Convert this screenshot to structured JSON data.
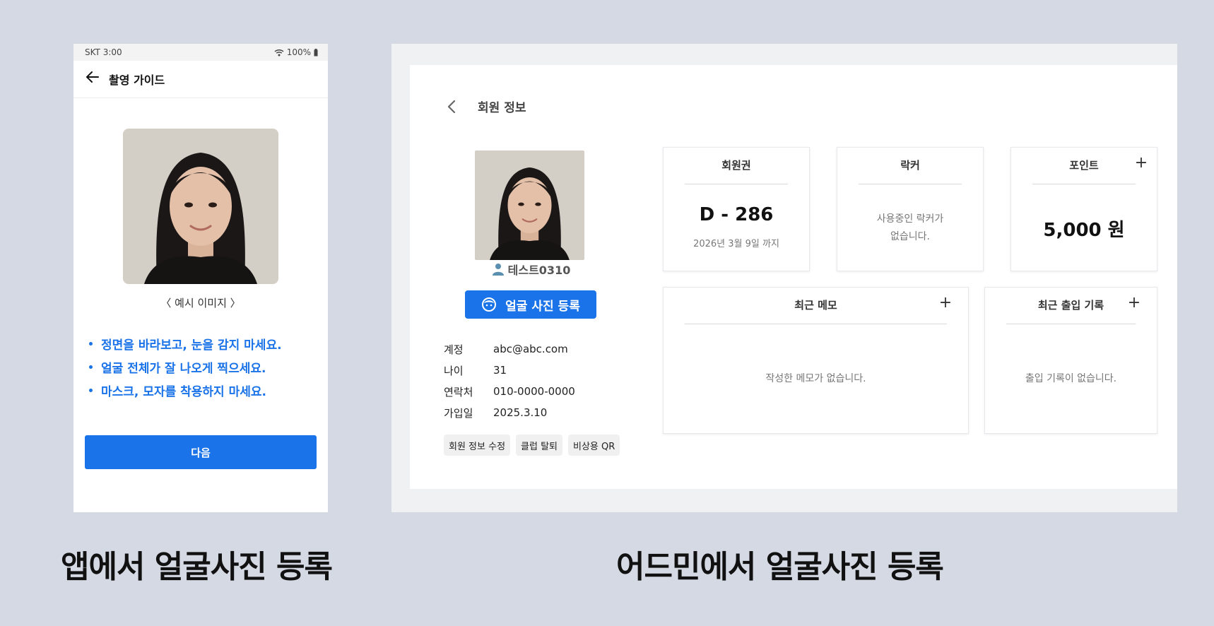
{
  "phone": {
    "status": {
      "carrier_time": "SKT 3:00",
      "battery": "100%"
    },
    "title": "촬영 가이드",
    "photo_caption": "〈 예시 이미지 〉",
    "guide_items": [
      "정면을 바라보고, 눈을 감지 마세요.",
      "얼굴 전체가 잘 나오게 찍으세요.",
      "마스크, 모자를 착용하지 마세요."
    ],
    "next_label": "다음"
  },
  "admin": {
    "title": "회원 정보",
    "profile": {
      "name": "테스트0310",
      "face_button": "얼굴 사진 등록"
    },
    "info": [
      {
        "key": "계정",
        "value": "abc@abc.com"
      },
      {
        "key": "나이",
        "value": "31"
      },
      {
        "key": "연락처",
        "value": "010-0000-0000"
      },
      {
        "key": "가입일",
        "value": "2025.3.10"
      }
    ],
    "actions": [
      "회원 정보 수정",
      "클럽 탈퇴",
      "비상용 QR"
    ],
    "cards": {
      "membership": {
        "title": "회원권",
        "value": "D - 286",
        "sub": "2026년 3월 9일 까지"
      },
      "locker": {
        "title": "락커",
        "empty_line1": "사용중인 락커가",
        "empty_line2": "없습니다."
      },
      "points": {
        "title": "포인트",
        "value": "5,000 원",
        "plus": "+"
      },
      "memo": {
        "title": "최근 메모",
        "empty": "작성한 메모가 없습니다.",
        "plus": "+"
      },
      "access": {
        "title": "최근 출입 기록",
        "empty": "출입 기록이 없습니다.",
        "plus": "+"
      }
    }
  },
  "captions": {
    "left": "앱에서 얼굴사진 등록",
    "right": "어드민에서 얼굴사진 등록"
  },
  "colors": {
    "background": "#d4d9e3",
    "accent": "#1a73e8"
  },
  "icons": [
    "wifi-icon",
    "battery-icon",
    "back-arrow-icon",
    "chevron-left-icon",
    "user-icon",
    "face-icon",
    "plus-icon"
  ]
}
